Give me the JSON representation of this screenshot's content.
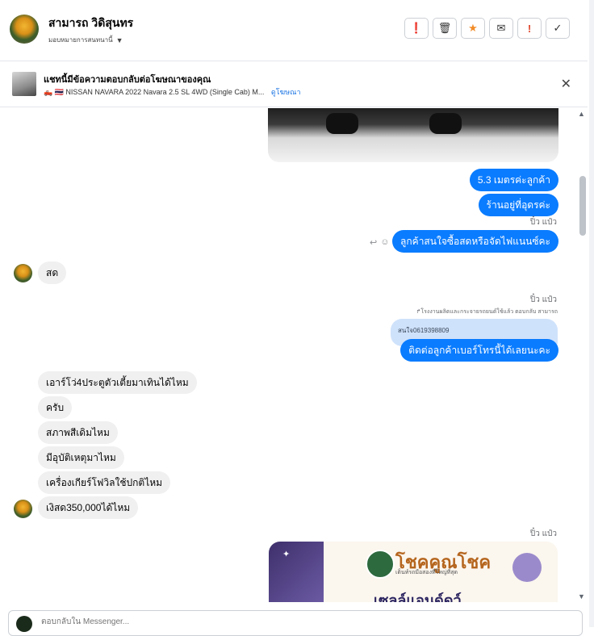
{
  "header": {
    "contact_name": "สามารถ วิดิสุนทร",
    "assign_label": "มอบหมายการสนทนานี้",
    "tool_icons": [
      "alert-icon",
      "trash-icon",
      "star-icon",
      "mail-icon",
      "exclamation-icon",
      "check-icon"
    ],
    "tool_glyphs": [
      "❗",
      "🗑",
      "★",
      "✉",
      "!",
      "✓"
    ]
  },
  "banner": {
    "title": "แชทนี้มีข้อความตอบกลับต่อโฆษณาของคุณ",
    "subtitle": "🛻 🇹🇭 NISSAN NAVARA 2022 Navara 2.5 SL 4WD (Single Cab) M...",
    "link": "ดูโฆษณา",
    "close": "✕"
  },
  "messages": {
    "m1": "5.3 เมตรค่ะลูกค้า",
    "m2": "ร้านอยู่ที่อุดรค่ะ",
    "seen1": "ปิ๋ว แป๋ว",
    "m3": "ลูกค้าสนใจซื้อสดหรือจัดไฟแนนซ์คะ",
    "in1": "สด",
    "seen2": "ปิ๋ว แป๋ว",
    "reply_note": "↱โรงงานผลิตและกระจายรถยนต์ใช้แล้ว ตอบกลับ สามารถ",
    "quoted": "สนใจ0619398809",
    "m4": "ติดต่อลูกค้าเบอร์โทรนี้ได้เลยนะคะ",
    "in2": "เอาร์โว่4ประตูตัวเตี้ยมาเทินได้ไหม",
    "in3": "ครับ",
    "in4": "สภาพสีเดิมไหม",
    "in5": "มีอุบัติเหตุมาไหม",
    "in6": "เครื่องเกียร์โฟวิลใช้ปกติไหม",
    "in7": "เงิสด350,000ได้ไหม",
    "seen3": "ปิ๋ว แป๋ว"
  },
  "card": {
    "brand": "โชคคูณโชค",
    "tagline": "เต็นท์รถมือสองที่ใหญ่ที่สุด",
    "sale": "เซลล์แอนด์ดว์"
  },
  "composer": {
    "placeholder": "ตอบกลับใน Messenger..."
  }
}
